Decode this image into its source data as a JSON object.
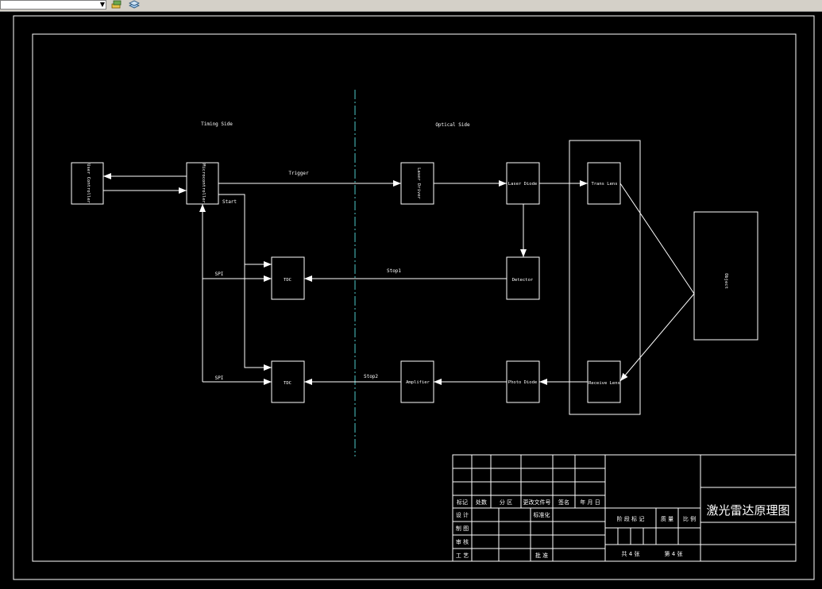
{
  "toolbar": {
    "layer_combo_icon": "chevron-down-icon",
    "icons": [
      "layer-properties-icon",
      "layer-stack-icon"
    ]
  },
  "diagram": {
    "side_left": "Timing Side",
    "side_right": "Optical Side",
    "blocks": {
      "user_controller": "User Controller",
      "microcontroller": "Microcontroller",
      "laser_driver": "Laser Driver",
      "laser_diode": "Laser Diode",
      "trans_lens": "Trans Lens",
      "detector": "Detector",
      "tdc1": "TDC",
      "tdc2": "TDC",
      "amplifier": "Amplifier",
      "photo_diode": "Photo Diode",
      "receive_lens": "Receive Lens",
      "object": "Object"
    },
    "labels": {
      "trigger": "Trigger",
      "start": "Start",
      "stop1": "Stop1",
      "stop2": "Stop2",
      "spi1": "SPI",
      "spi2": "SPI"
    }
  },
  "title_block": {
    "drawing_title": "激光雷达原理图",
    "header_cells": [
      "标记",
      "处数",
      "分 区",
      "更改文件号",
      "签名",
      "年 月 日"
    ],
    "rows": [
      "设 计",
      "制 图",
      "审 核",
      "工 艺"
    ],
    "standardize": "标准化",
    "approve": "批 准",
    "stage_cols": [
      "阶 段 标 记",
      "质 量",
      "比 例"
    ],
    "sheets_total": "共 4 张",
    "sheet_no": "第 4 张"
  }
}
